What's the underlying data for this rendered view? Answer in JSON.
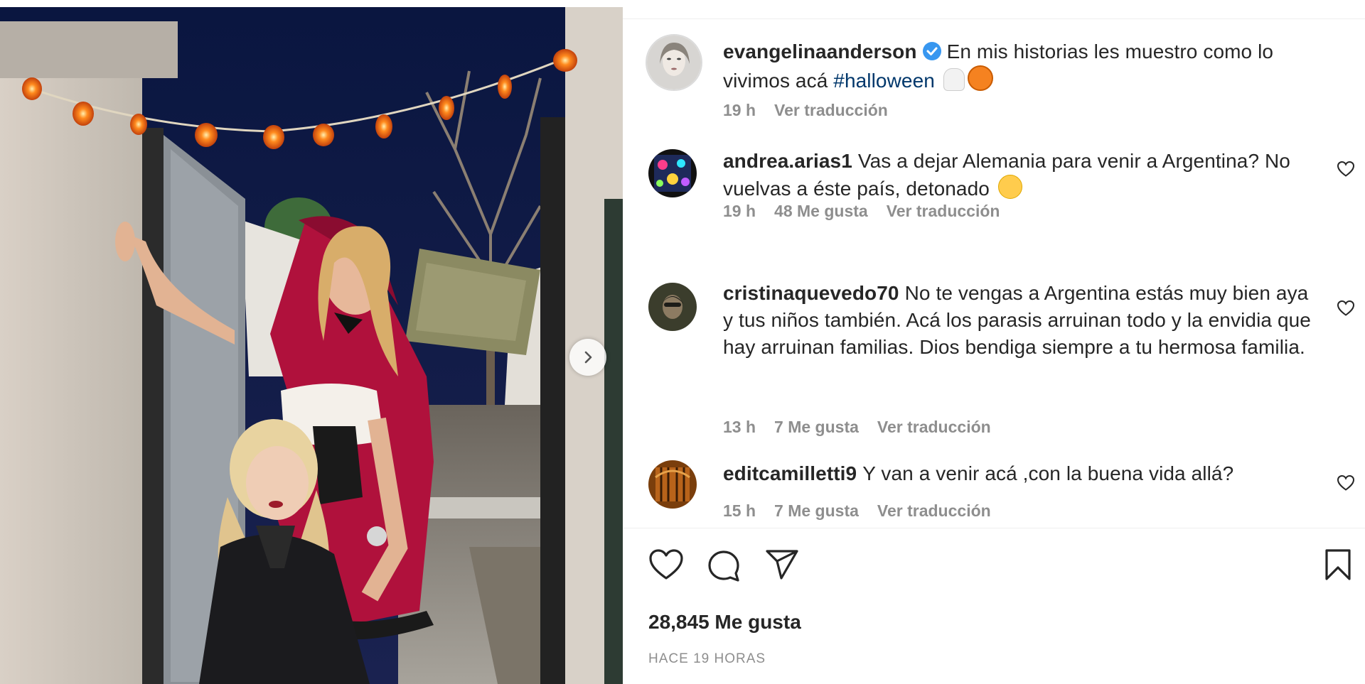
{
  "post": {
    "author": "evangelinaanderson",
    "caption": "En mis historias les muestro como lo vivimos acá",
    "hashtag": "#halloween",
    "time": "19 h",
    "translate": "Ver traducción"
  },
  "comments": [
    {
      "user": "andrea.arias1",
      "text": "Vas a dejar Alemania para venir a Argentina? No vuelvas a éste país, detonado",
      "time": "19 h",
      "likes": "48 Me gusta",
      "translate": "Ver traducción"
    },
    {
      "user": "cristinaquevedo70",
      "text": "No te vengas a Argentina estás muy bien aya y tus niños también. Acá los parasis arruinan todo y la envidia que hay arruinan familias. Dios bendiga siempre a tu hermosa familia.",
      "time": "13 h",
      "likes": "7 Me gusta",
      "translate": "Ver traducción"
    },
    {
      "user": "editcamilletti9",
      "text": "Y van a venir acá ,con la buena vida allá?",
      "time": "15 h",
      "likes": "7 Me gusta",
      "translate": "Ver traducción"
    }
  ],
  "footer": {
    "likes": "28,845 Me gusta",
    "time": "HACE 19 HORAS"
  },
  "icons": {
    "verified": "verified-badge-icon",
    "like": "heart-icon",
    "comment": "comment-icon",
    "share": "paper-plane-icon",
    "save": "bookmark-icon",
    "next": "chevron-right-icon"
  },
  "colors": {
    "text": "#262626",
    "secondary": "#8e8e8e",
    "hashtag": "#00376b",
    "verified": "#3897f0"
  }
}
